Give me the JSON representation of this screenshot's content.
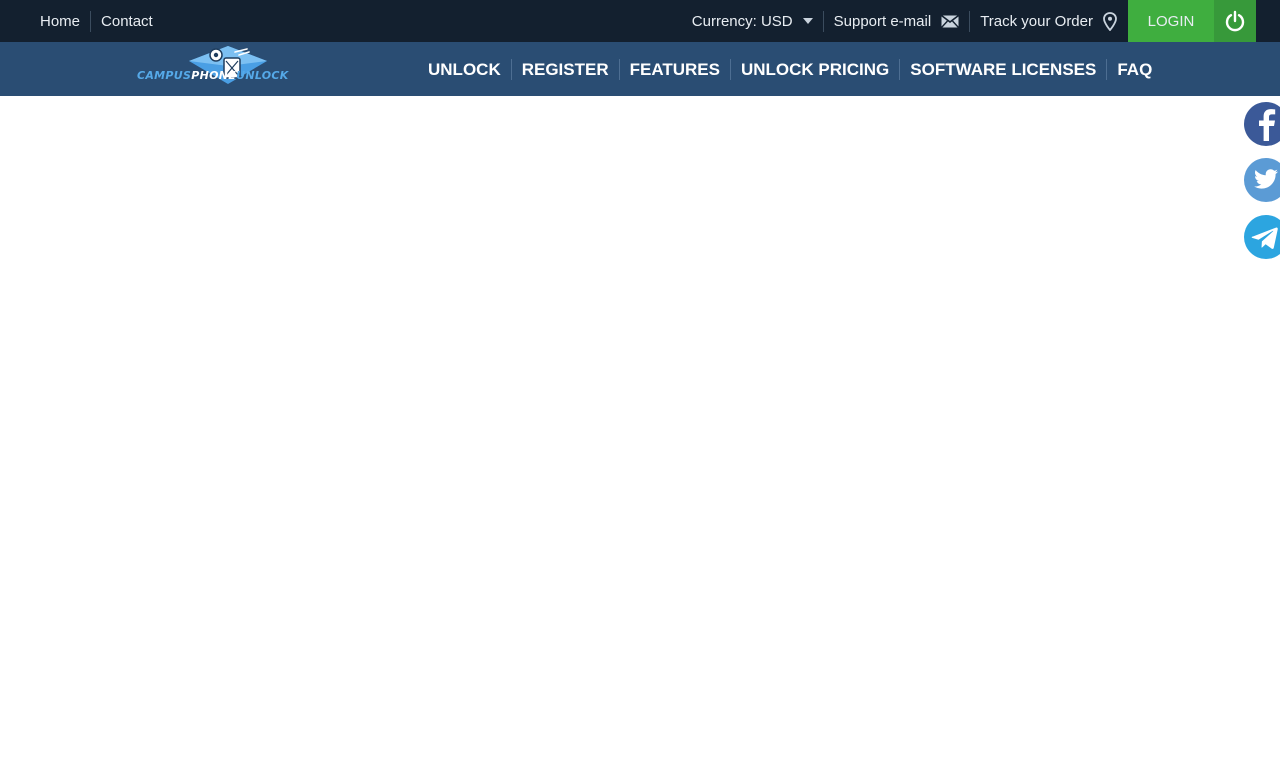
{
  "topbar": {
    "left_links": [
      {
        "label": "Home"
      },
      {
        "label": "Contact"
      }
    ],
    "currency": {
      "label": "Currency: USD"
    },
    "support": {
      "label": "Support e-mail",
      "icon": "envelope-icon"
    },
    "track": {
      "label": "Track your Order",
      "icon": "map-pin-icon"
    },
    "login": {
      "label": "LOGIN",
      "icon": "power-icon"
    }
  },
  "logo": {
    "part1": "CAMPUS",
    "part2": "PHONE",
    "part3": "UNLOCK"
  },
  "nav": {
    "items": [
      {
        "label": "UNLOCK"
      },
      {
        "label": "REGISTER"
      },
      {
        "label": "FEATURES"
      },
      {
        "label": "UNLOCK PRICING"
      },
      {
        "label": "SOFTWARE LICENSES"
      },
      {
        "label": "FAQ"
      }
    ]
  },
  "social": {
    "items": [
      {
        "name": "facebook",
        "icon": "facebook-icon",
        "color": "#3b5998"
      },
      {
        "name": "twitter",
        "icon": "twitter-icon",
        "color": "#5b9bd5"
      },
      {
        "name": "telegram",
        "icon": "telegram-icon",
        "color": "#2ca5e0"
      }
    ]
  },
  "colors": {
    "topbar_bg": "#13202f",
    "navbar_bg": "#2a4d73",
    "login_bg": "#3fae3f",
    "logo_blue": "#55a9e8"
  }
}
